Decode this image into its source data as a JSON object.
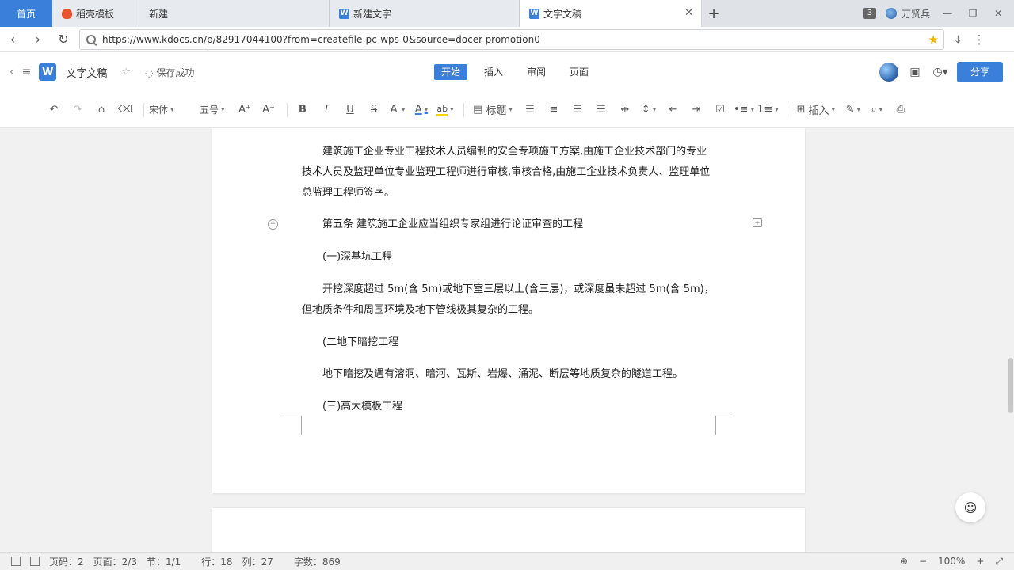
{
  "tabs": {
    "home": "首页",
    "items": [
      {
        "label": "稻壳模板",
        "icon": "docer-fire-icon"
      },
      {
        "label": "新建",
        "icon": ""
      },
      {
        "label": "新建文字",
        "icon": "wps-writer-icon"
      },
      {
        "label": "文字文稿",
        "icon": "wps-writer-icon"
      }
    ],
    "new_tab": "+",
    "window_count": "3",
    "user_name": "万贤兵"
  },
  "address": {
    "url": "https://www.kdocs.cn/p/82917044100?from=createfile-pc-wps-0&source=docer-promotion0"
  },
  "doc_header": {
    "logo": "W",
    "title": "文字文稿",
    "save_status": "保存成功",
    "menus": [
      "开始",
      "插入",
      "审阅",
      "页面"
    ],
    "active_menu": "开始",
    "share": "分享"
  },
  "toolbar": {
    "font": "宋体",
    "size": "五号",
    "heading": "标题",
    "insert": "插入"
  },
  "document": {
    "paragraphs": [
      "建筑施工企业专业工程技术人员编制的安全专项施工方案,由施工企业技术部门的专业技术人员及监理单位专业监理工程师进行审核,审核合格,由施工企业技术负责人、监理单位总监理工程师签字。",
      "第五条 建筑施工企业应当组织专家组进行论证审查的工程",
      "(一)深基坑工程",
      "开挖深度超过 5m(含 5m)或地下室三层以上(含三层)，或深度虽未超过 5m(含 5m)，但地质条件和周围环境及地下管线极其复杂的工程。",
      "(二地下暗挖工程",
      "地下暗挖及遇有溶洞、暗河、瓦斯、岩爆、涌泥、断层等地质复杂的隧道工程。",
      "(三)高大模板工程"
    ]
  },
  "status": {
    "page_code": "页码：2",
    "page": "页面：2/3",
    "section": "节：1/1",
    "row": "行：18",
    "col": "列：27",
    "words": "字数：869",
    "zoom": "100%"
  },
  "colors": {
    "accent": "#3a7fd9",
    "star": "#f5b800"
  }
}
